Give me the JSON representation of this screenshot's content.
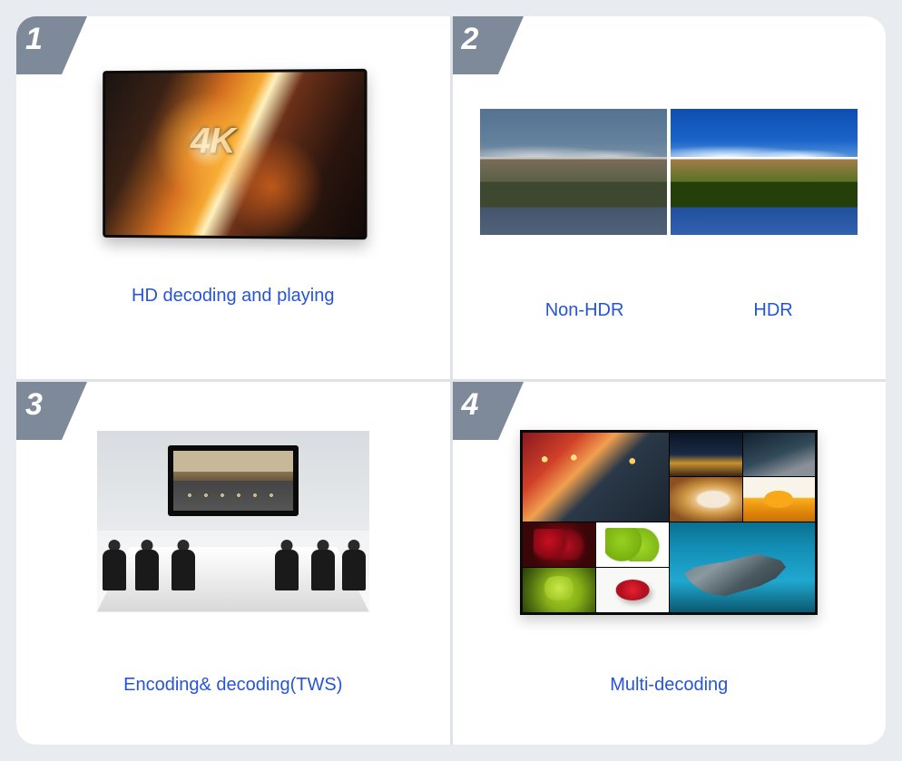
{
  "cells": [
    {
      "number": "1",
      "label": "HD decoding and playing",
      "img_text": "4K"
    },
    {
      "number": "2",
      "sub_labels": [
        "Non-HDR",
        "HDR"
      ]
    },
    {
      "number": "3",
      "label": "Encoding& decoding(TWS)"
    },
    {
      "number": "4",
      "label": "Multi-decoding"
    }
  ],
  "colors": {
    "accent": "#2554d9",
    "badge": "#7e8a99"
  }
}
